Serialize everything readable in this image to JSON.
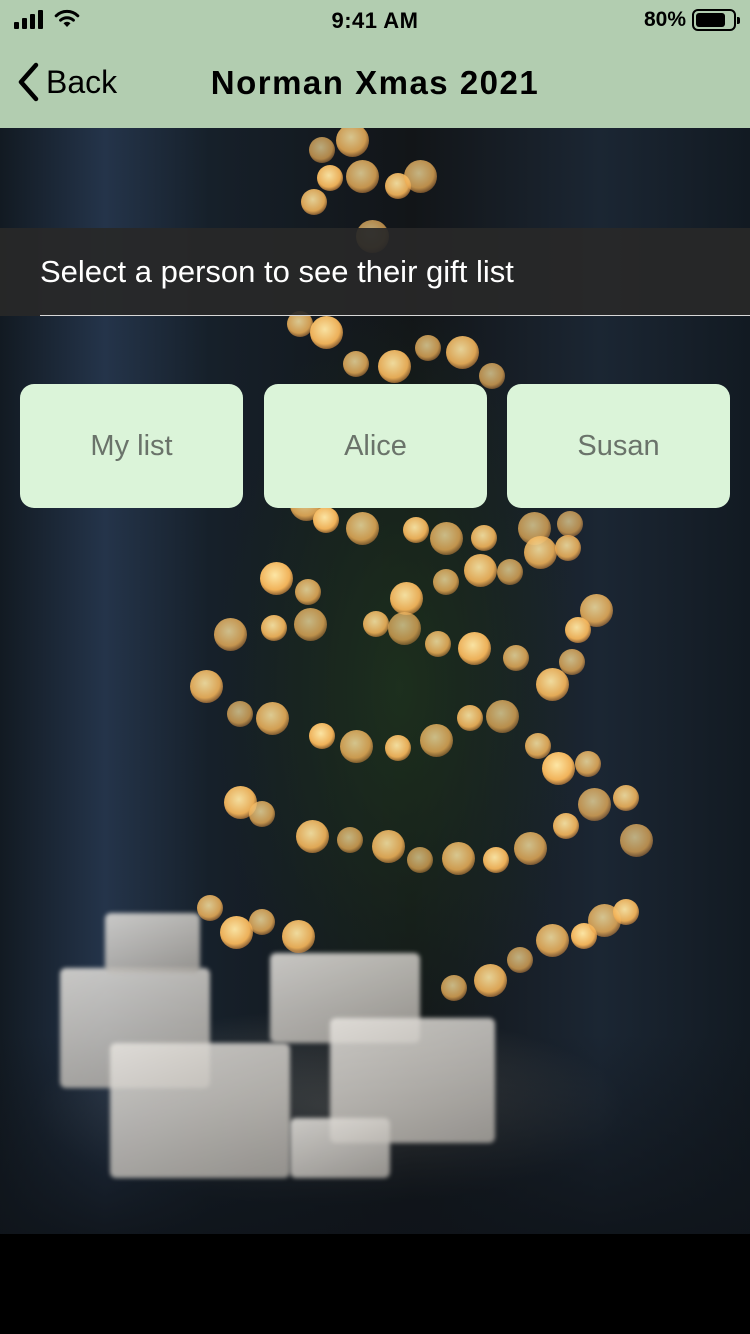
{
  "status_bar": {
    "time": "9:41 AM",
    "battery_percent": "80%",
    "battery_level": 0.8,
    "signal_icon": "cellular-signal-icon",
    "wifi_icon": "wifi-icon",
    "battery_icon": "battery-icon"
  },
  "nav": {
    "back_label": "Back",
    "back_icon": "chevron-left-icon",
    "title": "Norman Xmas 2021"
  },
  "prompt": {
    "text": "Select a person to see their gift list"
  },
  "people": [
    {
      "label": "My list"
    },
    {
      "label": "Alice"
    },
    {
      "label": "Susan"
    }
  ],
  "colors": {
    "header_bg": "#b2cdb0",
    "button_bg": "#dbf4d9",
    "button_text": "#6a736a",
    "prompt_bg": "#282828"
  }
}
